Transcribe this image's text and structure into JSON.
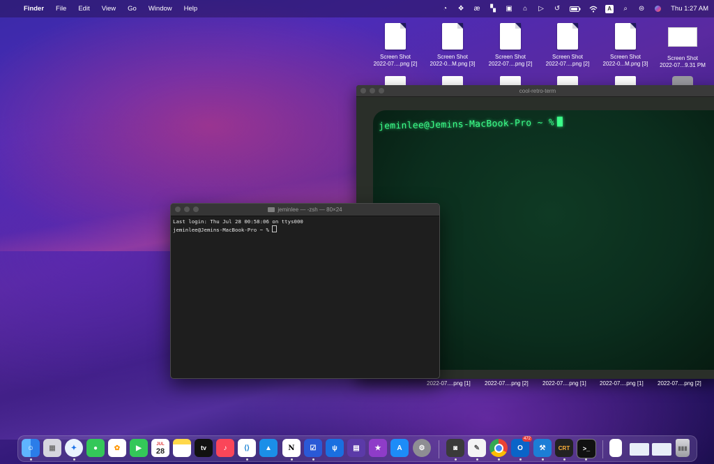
{
  "menubar": {
    "app": "Finder",
    "items": [
      "File",
      "Edit",
      "View",
      "Go",
      "Window",
      "Help"
    ],
    "clock": "Thu 1:27 AM",
    "status_icons": [
      "focus-icon",
      "dropbox-icon",
      "ae-icon",
      "layout-icon",
      "calendar-icon",
      "bed-icon",
      "play-icon",
      "time-machine-icon",
      "battery-icon",
      "wifi-icon",
      "keyboard-input-icon",
      "search-icon",
      "control-center-icon",
      "siri-icon"
    ]
  },
  "desktop": {
    "top_icons": [
      {
        "line1": "Screen Shot",
        "line2": "2022-07....png [2]"
      },
      {
        "line1": "Screen Shot",
        "line2": "2022-0...M.png [3]"
      },
      {
        "line1": "Screen Shot",
        "line2": "2022-07....png [2]"
      },
      {
        "line1": "Screen Shot",
        "line2": "2022-07....png [2]"
      },
      {
        "line1": "Screen Shot",
        "line2": "2022-0...M.png [3]"
      },
      {
        "line1": "Screen Shot",
        "line2": "2022-07...9.31 PM"
      }
    ],
    "bottom_labels": [
      "2022-07....png [1]",
      "2022-07....png [2]",
      "2022-07....png [1]",
      "2022-07....png [1]",
      "2022-07....png [2]"
    ]
  },
  "retro_term": {
    "title": "cool-retro-term",
    "prompt": "jeminlee@Jemins-MacBook-Pro ~ %"
  },
  "terminal": {
    "title": "jeminlee — -zsh — 80×24",
    "line1": "Last login: Thu Jul 28 00:58:06 on ttys000",
    "line2": "jeminlee@Jemins-MacBook-Pro ~ % "
  },
  "dock": {
    "calendar_month": "JUL",
    "calendar_day": "28",
    "tv_label": "tv",
    "notion_label": "N",
    "crt_label": "CRT",
    "outlook_badge": "472"
  }
}
